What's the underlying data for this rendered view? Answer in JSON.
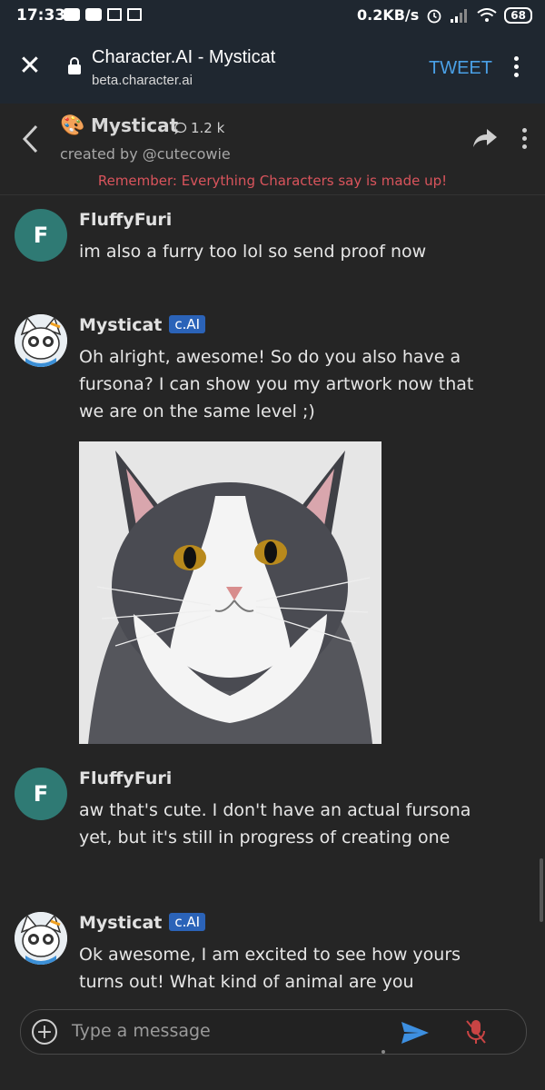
{
  "status_bar": {
    "time": "17:33",
    "speed": "0.2KB/s",
    "battery": "68"
  },
  "browser": {
    "title": "Character.AI - Mysticat",
    "url": "beta.character.ai",
    "tweet_label": "TWEET"
  },
  "chat_header": {
    "emoji": "🎨",
    "name": "Mysticat",
    "interactions": "1.2 k",
    "creator": "created by @cutecowie",
    "warning": "Remember: Everything Characters say is made up!"
  },
  "messages": [
    {
      "author": "FluffyFuri",
      "avatar_letter": "F",
      "text": "im also a furry too lol so send proof now"
    },
    {
      "author": "Mysticat",
      "badge": "c.AI",
      "text": "Oh alright, awesome! So do you also have a fursona? I can show you my artwork now that we are on the same level ;)"
    },
    {
      "author": "FluffyFuri",
      "avatar_letter": "F",
      "text": "aw that's cute. I don't have an actual fursona yet, but it's still in progress of creating one"
    },
    {
      "author": "Mysticat",
      "badge": "c.AI",
      "text": "Ok awesome, I am excited to see how yours turns out! What kind of animal are you"
    }
  ],
  "composer": {
    "placeholder": "Type a message"
  },
  "colors": {
    "background": "#252525",
    "topbar": "#1f2730",
    "accent_link": "#4aa0e6",
    "warning": "#d9545c",
    "badge": "#2b63b8",
    "user_avatar": "#2f7a74",
    "send_icon": "#3d8fe0",
    "mic_muted": "#c94444"
  }
}
